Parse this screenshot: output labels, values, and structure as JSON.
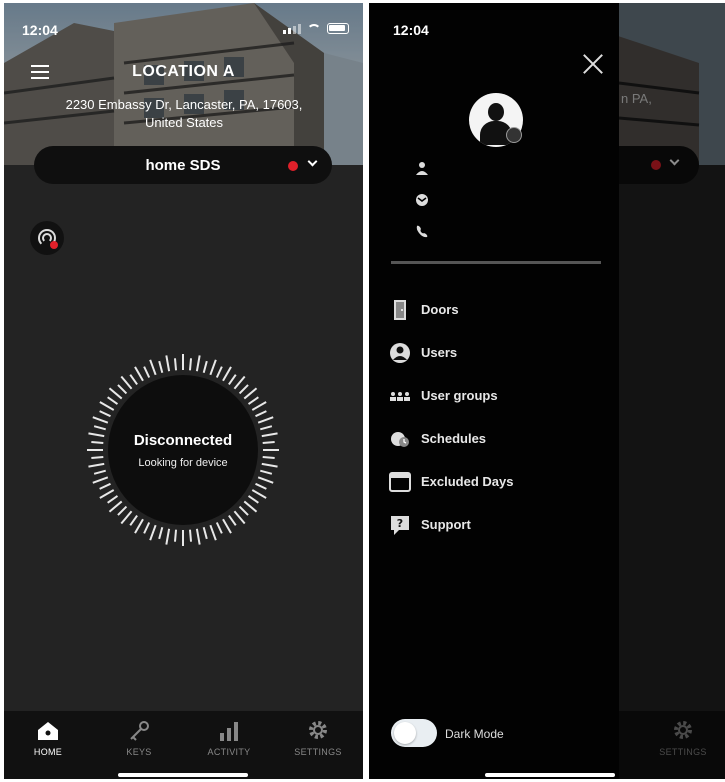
{
  "home_screen": {
    "status_time": "12:04",
    "location_title": "LOCATION A",
    "address": "2230 Embassy Dr, Lancaster, PA, 17603, United States",
    "site_name": "home SDS",
    "site_status_color": "#e0202a",
    "lock_status": "Disconnected",
    "lock_status_sub": "Looking for device",
    "tabs": [
      {
        "label": "HOME",
        "icon": "home-icon",
        "active": true
      },
      {
        "label": "KEYS",
        "icon": "key-icon",
        "active": false
      },
      {
        "label": "ACTIVITY",
        "icon": "activity-icon",
        "active": false
      },
      {
        "label": "SETTINGS",
        "icon": "gear-icon",
        "active": false
      }
    ]
  },
  "drawer_screen": {
    "status_time": "12:04",
    "address_fragment": "n PA,",
    "profile_rows": [
      {
        "icon": "person-icon"
      },
      {
        "icon": "mail-icon"
      },
      {
        "icon": "phone-icon"
      }
    ],
    "menu_items": [
      {
        "label": "Doors",
        "icon": "door-icon"
      },
      {
        "label": "Users",
        "icon": "user-icon"
      },
      {
        "label": "User groups",
        "icon": "user-groups-icon"
      },
      {
        "label": "Schedules",
        "icon": "schedule-icon"
      },
      {
        "label": "Excluded Days",
        "icon": "calendar-icon"
      },
      {
        "label": "Support",
        "icon": "support-icon"
      }
    ],
    "dark_mode_label": "Dark Mode",
    "dark_mode_on": false,
    "settings_tab_label": "SETTINGS"
  }
}
